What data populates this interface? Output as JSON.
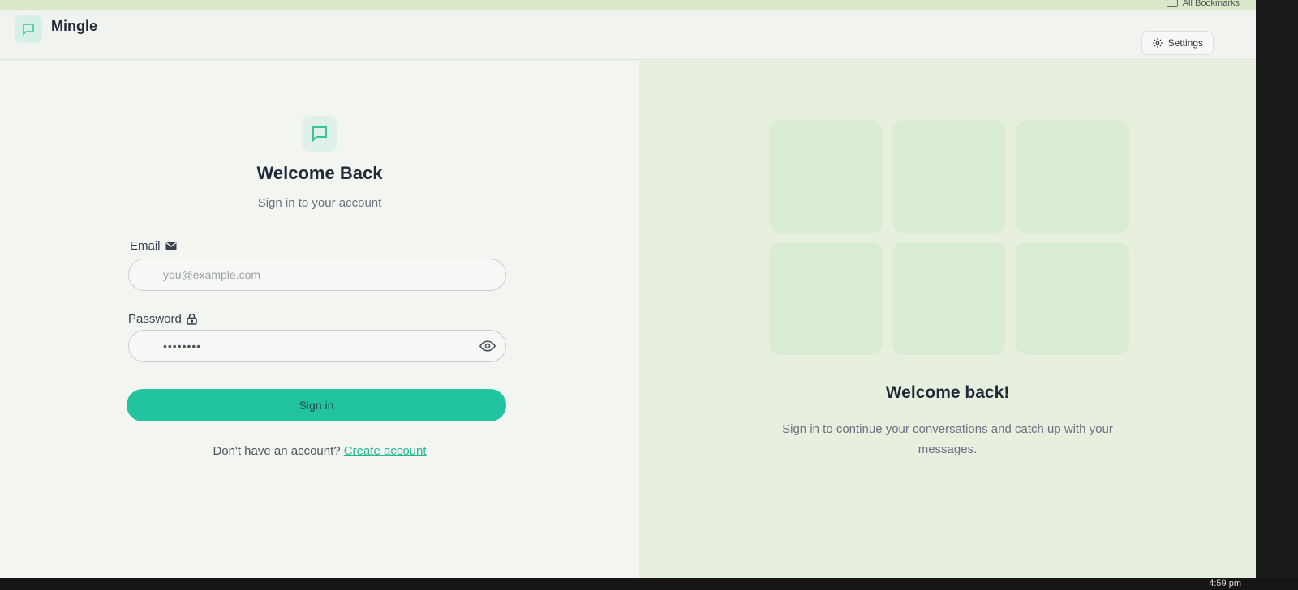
{
  "browser": {
    "bookmarks_label": "All Bookmarks"
  },
  "header": {
    "brand": "Mingle",
    "settings_label": "Settings"
  },
  "login": {
    "title": "Welcome Back",
    "subtitle": "Sign in to your account",
    "email_label": "Email",
    "email_placeholder": "you@example.com",
    "password_label": "Password",
    "password_value": "••••••••",
    "signin_label": "Sign in",
    "no_account_text": "Don't have an account?",
    "create_account_label": "Create account"
  },
  "promo": {
    "title": "Welcome back!",
    "subtitle": "Sign in to continue your conversations and catch up with your messages."
  },
  "taskbar": {
    "clock": "4:59 pm"
  },
  "colors": {
    "accent": "#22c3a0",
    "link": "#22b894"
  }
}
